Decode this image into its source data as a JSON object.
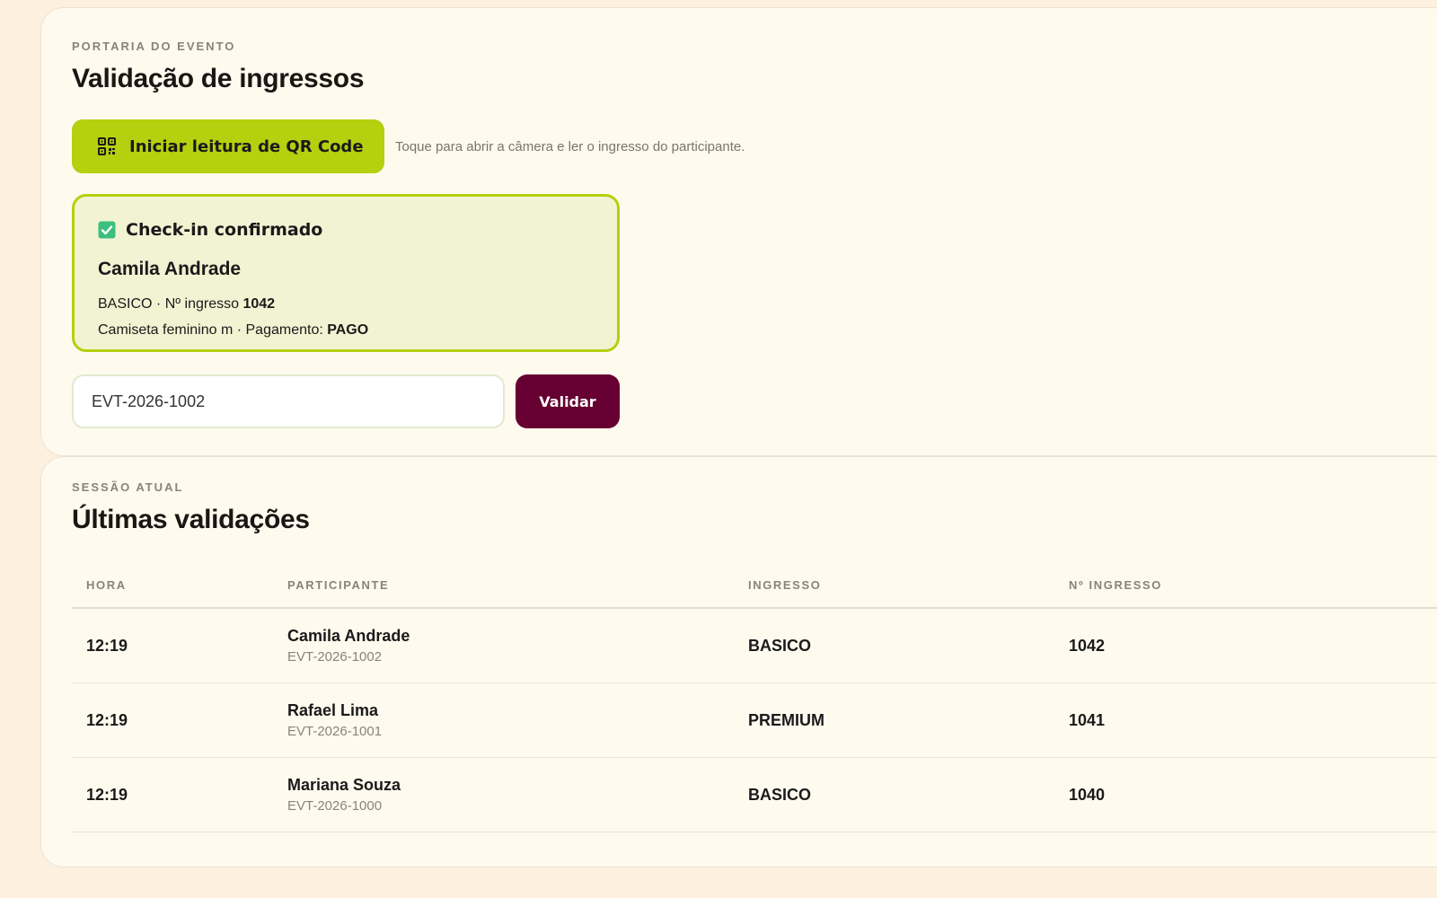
{
  "validation": {
    "eyebrow": "PORTARIA DO EVENTO",
    "title": "Validação de ingressos",
    "scan_button_label": "Iniciar leitura de QR Code",
    "scan_hint": "Toque para abrir a câmera e ler o ingresso do participante.",
    "status": {
      "title": "Check-in confirmado",
      "name": "Camila Andrade",
      "ticket_type": "BASICO",
      "ticket_number_label": "Nº ingresso",
      "ticket_number": "1042",
      "shirt": "Camiseta feminino m",
      "payment_label": "Pagamento:",
      "payment_status": "PAGO"
    },
    "input_value": "EVT-2026-1002",
    "validate_button_label": "Validar"
  },
  "session": {
    "eyebrow": "SESSÃO ATUAL",
    "title": "Últimas validações",
    "columns": [
      "HORA",
      "PARTICIPANTE",
      "INGRESSO",
      "Nº INGRESSO"
    ],
    "rows": [
      {
        "time": "12:19",
        "name": "Camila Andrade",
        "code": "EVT-2026-1002",
        "type": "BASICO",
        "number": "1042"
      },
      {
        "time": "12:19",
        "name": "Rafael Lima",
        "code": "EVT-2026-1001",
        "type": "PREMIUM",
        "number": "1041"
      },
      {
        "time": "12:19",
        "name": "Mariana Souza",
        "code": "EVT-2026-1000",
        "type": "BASICO",
        "number": "1040"
      }
    ]
  },
  "colors": {
    "background": "#fdf0de",
    "card": "#fffaee",
    "accent_lime": "#b4d00e",
    "status_bg": "#f2f3d2",
    "validate_button": "#660032",
    "check_green": "#3bbf7e"
  },
  "icons": {
    "scan_button": "qr-code-icon",
    "status": "check-icon"
  }
}
